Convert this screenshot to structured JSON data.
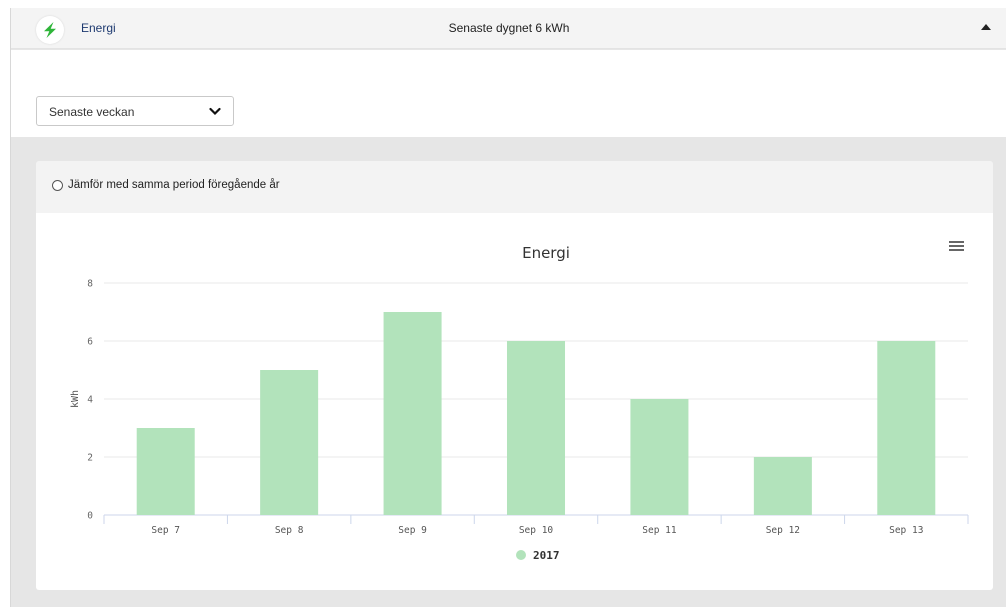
{
  "header": {
    "title": "Energi",
    "summary": "Senaste dygnet 6 kWh",
    "logo_icon": "lightning-bolt-icon",
    "collapse_icon": "caret-up-icon"
  },
  "filters": {
    "period_selected": "Senaste veckan",
    "compare_label": "Jämför med samma period föregående år",
    "compare_checked": false
  },
  "colors": {
    "accent": "#1e3a70",
    "bolt": "#2fb53a",
    "bar": "#b2e3bb",
    "legend_marker": "#b2e3bb"
  },
  "chart_data": {
    "type": "bar",
    "title": "Energi",
    "xlabel": "",
    "ylabel": "kWh",
    "categories": [
      "Sep 7",
      "Sep 8",
      "Sep 9",
      "Sep 10",
      "Sep 11",
      "Sep 12",
      "Sep 13"
    ],
    "series": [
      {
        "name": "2017",
        "values": [
          3,
          5,
          7,
          6,
          4,
          2,
          6
        ]
      }
    ],
    "ylim": [
      0,
      8
    ],
    "yticks": [
      0,
      2,
      4,
      6,
      8
    ],
    "grid": true,
    "legend_position": "bottom"
  }
}
